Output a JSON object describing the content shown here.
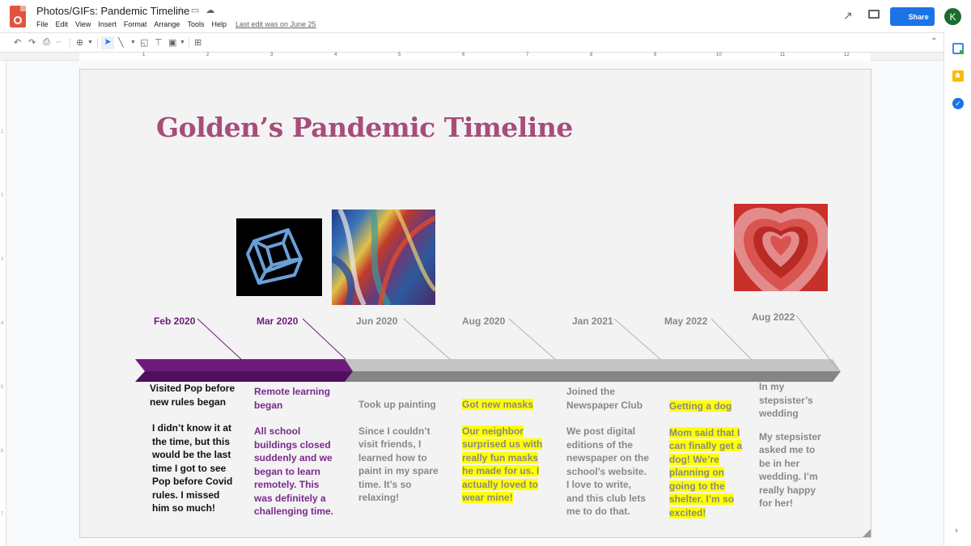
{
  "app": {
    "doc_title": "Photos/GIFs: Pandemic Timeline",
    "title_icons": [
      "star-icon",
      "folder-icon",
      "cloud-icon"
    ],
    "menu": [
      "File",
      "Edit",
      "View",
      "Insert",
      "Format",
      "Arrange",
      "Tools",
      "Help"
    ],
    "last_edit": "Last edit was on June 25",
    "share_label": "Share",
    "avatar_initial": "K",
    "brand_color": "#1a73e8"
  },
  "toolbar": {
    "icons": [
      "undo-icon",
      "redo-icon",
      "print-icon",
      "paint-format-icon",
      "zoom-icon",
      "zoom-dropdown-icon",
      "select-icon",
      "line-icon",
      "line-dropdown-icon",
      "shape-icon",
      "textbox-icon",
      "image-icon",
      "image-dropdown-icon",
      "comment-icon"
    ]
  },
  "ruler": {
    "h_numbers": [
      "1",
      "2",
      "3",
      "4",
      "5",
      "6",
      "7",
      "8",
      "9",
      "10",
      "11",
      "12"
    ],
    "v_numbers": [
      "1",
      "2",
      "3",
      "4",
      "5",
      "6",
      "7"
    ]
  },
  "side_panel": [
    "calendar-icon",
    "keep-icon",
    "tasks-icon"
  ],
  "slide": {
    "title": "Golden’s Pandemic Timeline",
    "title_color": "#a64d79",
    "events": [
      {
        "date": "Feb 2020",
        "heading": [
          "Visited Pop before",
          "new rules began"
        ],
        "body": [
          "I didn’t know it at",
          "the time, but this",
          "would be the last",
          "time I got to see",
          "Pop before Covid",
          "rules. I missed",
          "him so much!"
        ],
        "style": "black",
        "highlight": false
      },
      {
        "date": "Mar 2020",
        "heading": [
          "Remote learning",
          "began"
        ],
        "body": [
          "All school",
          "buildings closed",
          "suddenly and we",
          "began to learn",
          "remotely. This",
          "was definitely a",
          "challenging time."
        ],
        "style": "purple",
        "highlight": false
      },
      {
        "date": "Jun 2020",
        "heading": [
          "Took up painting"
        ],
        "body": [
          "Since I couldn’t",
          "visit friends, I",
          "learned how to",
          "paint in my spare",
          "time. It’s so",
          "relaxing!"
        ],
        "style": "gray",
        "highlight": false
      },
      {
        "date": "Aug 2020",
        "heading": [
          "Got new masks"
        ],
        "body": [
          "Our neighbor",
          "surprised us with",
          "really fun masks",
          "he made for us. I",
          "actually loved to",
          "wear mine!"
        ],
        "style": "gray",
        "highlight": true
      },
      {
        "date": "Jan 2021",
        "heading": [
          "Joined the",
          "Newspaper Club"
        ],
        "body": [
          "We post digital",
          "editions of the",
          "newspaper on the",
          "school’s website.",
          "I love to write,",
          "and this club lets",
          "me to do that."
        ],
        "style": "gray",
        "highlight": false
      },
      {
        "date": "May 2022",
        "heading": [
          "Getting a dog"
        ],
        "body": [
          "Mom said that I",
          "can finally get a",
          "dog! We’re",
          "planning on",
          "going to the",
          "shelter. I’m so",
          "excited!"
        ],
        "style": "gray",
        "highlight": true
      },
      {
        "date": "Aug 2022",
        "heading": [
          "In my",
          "stepsister’s",
          "wedding"
        ],
        "body": [
          "My stepsister",
          "asked me to",
          "be in her",
          "wedding. I’m",
          "really happy",
          "for her!"
        ],
        "style": "gray",
        "highlight": false
      }
    ],
    "images": [
      "tesseract-gif",
      "abstract-painting-gif",
      "heart-gif"
    ],
    "colors": {
      "purple": "#6f1b7c",
      "purple_dark": "#4f0f5e",
      "gray_light": "#c4c4c4",
      "gray_dark": "#858585",
      "highlight": "#ffff00"
    }
  }
}
